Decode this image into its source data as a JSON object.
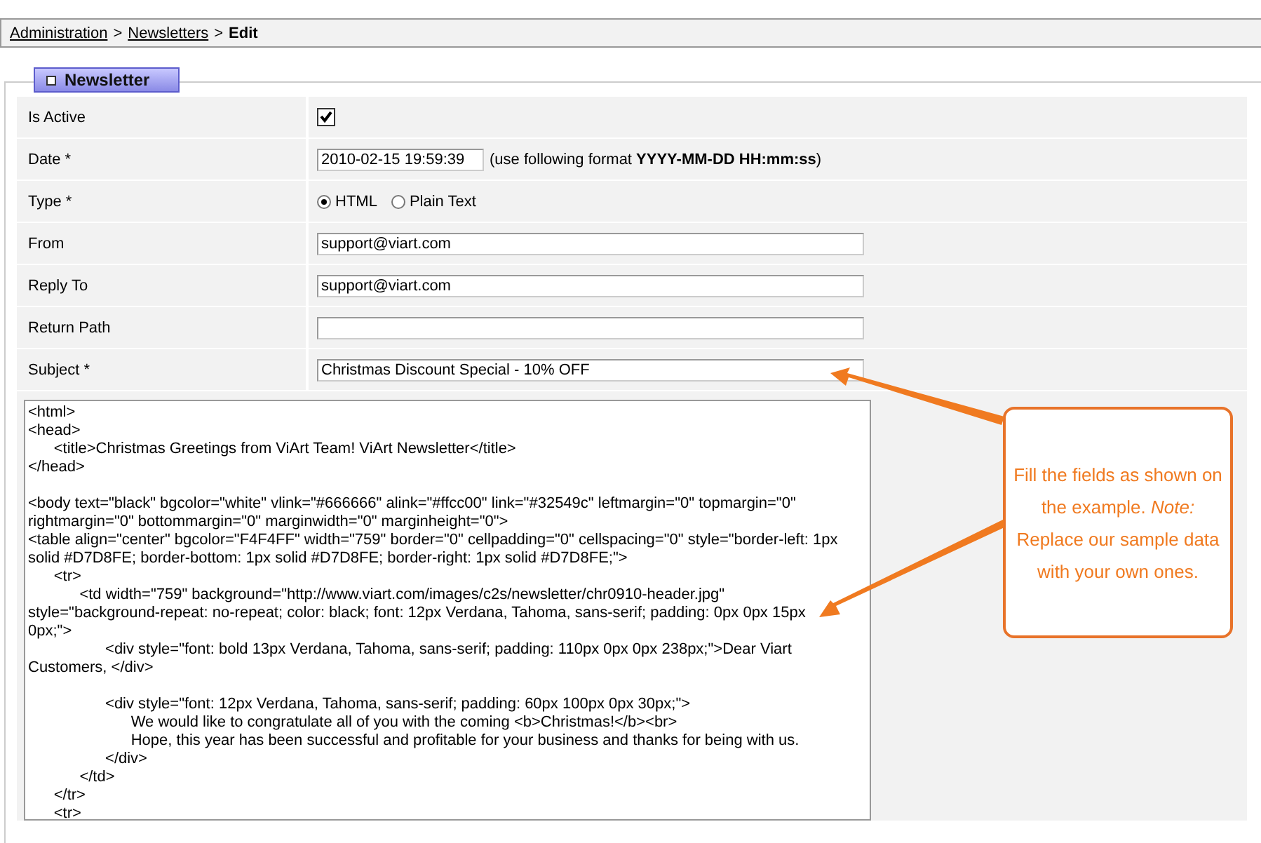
{
  "breadcrumb": [
    {
      "label": "Administration",
      "kind": "link"
    },
    {
      "label": ">",
      "kind": "sep"
    },
    {
      "label": "Newsletters",
      "kind": "link"
    },
    {
      "label": ">",
      "kind": "sep"
    },
    {
      "label": "Edit",
      "kind": "current"
    }
  ],
  "panel": {
    "title": "Newsletter"
  },
  "fields": [
    {
      "label": "Is Active",
      "kind": "checkbox",
      "checked": true
    },
    {
      "label": "Date *",
      "kind": "text",
      "value": "2010-02-15 19:59:39",
      "short": true,
      "note": "(use following format **YYYY-MM-DD HH:mm:ss**)"
    },
    {
      "label": "Type *",
      "kind": "radio",
      "options": [
        {
          "label": "HTML",
          "selected": true
        },
        {
          "label": "Plain Text",
          "selected": false
        }
      ]
    },
    {
      "label": "From",
      "kind": "text",
      "value": "support@viart.com"
    },
    {
      "label": "Reply To",
      "kind": "text",
      "value": "support@viart.com"
    },
    {
      "label": "Return Path",
      "kind": "text"
    },
    {
      "label": "Subject *",
      "kind": "text",
      "value": "Christmas Discount Special - 10% OFF"
    }
  ],
  "body": "<html>\n<head>\n\t<title>Christmas Greetings from ViArt Team! ViArt Newsletter</title>\n</head>\n\n<body text=\"black\" bgcolor=\"white\" vlink=\"#666666\" alink=\"#ffcc00\" link=\"#32549c\" leftmargin=\"0\" topmargin=\"0\" rightmargin=\"0\" bottommargin=\"0\" marginwidth=\"0\" marginheight=\"0\">\n<table align=\"center\" bgcolor=\"F4F4FF\" width=\"759\" border=\"0\" cellpadding=\"0\" cellspacing=\"0\" style=\"border-left: 1px solid #D7D8FE; border-bottom: 1px solid #D7D8FE; border-right: 1px solid #D7D8FE;\">\n\t<tr>\n\t\t<td width=\"759\" background=\"http://www.viart.com/images/c2s/newsletter/chr0910-header.jpg\" style=\"background-repeat: no-repeat; color: black; font: 12px Verdana, Tahoma, sans-serif; padding: 0px 0px 15px 0px;\">\n\t\t\t<div style=\"font: bold 13px Verdana, Tahoma, sans-serif; padding: 110px 0px 0px 238px;\">Dear Viart Customers, </div>\n\n\t\t\t<div style=\"font: 12px Verdana, Tahoma, sans-serif; padding: 60px 100px 0px 30px;\">\n\t\t\t\tWe would like to congratulate all of you with the coming <b>Christmas!</b><br>\n\t\t\t\tHope, this year has been successful and profitable for your business and thanks for being with us.\n\t\t\t</div>\n\t\t</td>\n\t</tr>\n\t<tr>",
  "callout": "Fill the fields as shown on the example. *Note:* Replace our sample data with your own ones."
}
